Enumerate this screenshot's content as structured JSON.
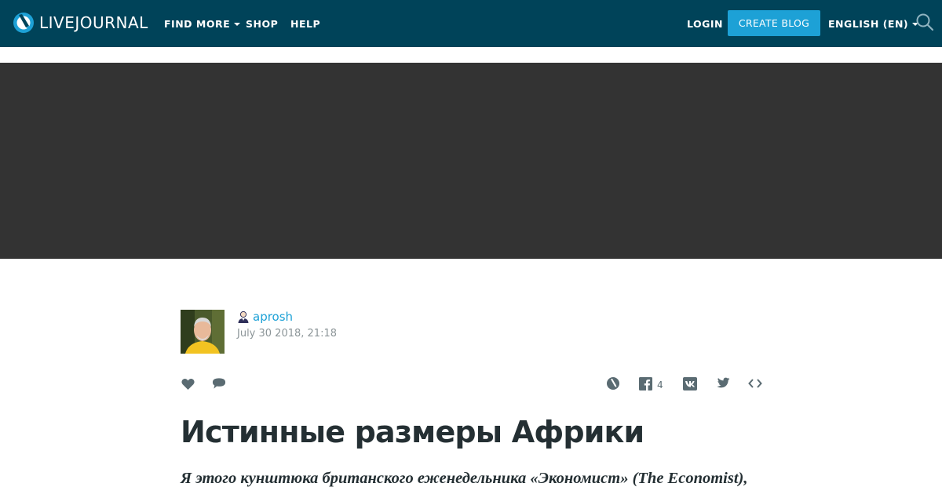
{
  "header": {
    "logo_text": "LIVEJOURNAL",
    "nav": [
      {
        "label": "FIND MORE",
        "has_dropdown": true
      },
      {
        "label": "SHOP",
        "has_dropdown": false
      },
      {
        "label": "HELP",
        "has_dropdown": false
      }
    ],
    "login_label": "LOGIN",
    "create_blog_label": "CREATE BLOG",
    "language_label": "ENGLISH (EN)",
    "icons": {
      "search": "search-icon",
      "logo": "livejournal-logo-icon"
    }
  },
  "post": {
    "author": "aprosh",
    "date": "July 30 2018, 21:18",
    "facebook_share_count": "4",
    "title": "Истинные размеры Африки",
    "lead": "Я этого кунштюка британского еженедельника «Экономист» (The Economist),",
    "icons": [
      "like-heart-icon",
      "comment-icon",
      "livejournal-share-icon",
      "facebook-icon",
      "vk-icon",
      "twitter-icon",
      "embed-code-icon"
    ]
  },
  "colors": {
    "header_bg": "#004359",
    "accent": "#1da1d6",
    "ad_bg": "#333333",
    "text": "#242f33",
    "muted": "#8c9598"
  }
}
